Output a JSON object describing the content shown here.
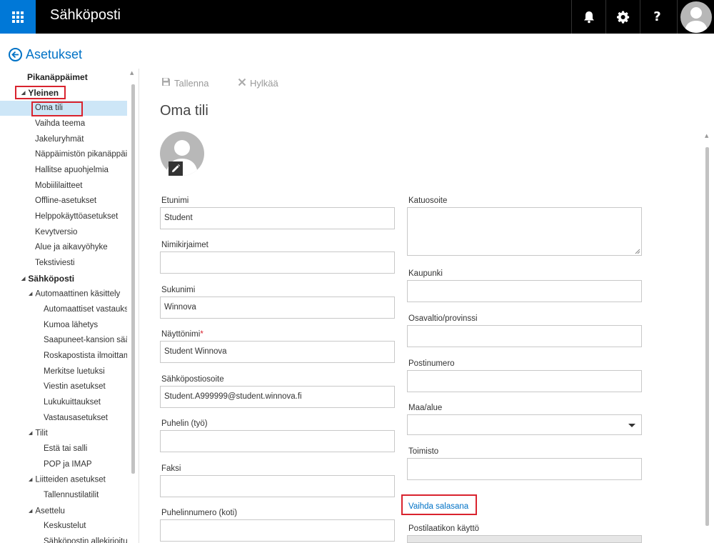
{
  "topbar": {
    "app_title": "Sähköposti",
    "waffle_icon": "app-launcher-icon",
    "bell_icon": "bell-icon",
    "gear_icon": "gear-icon",
    "help_glyph": "?",
    "avatar_icon": "user-avatar-icon",
    "accent_color": "#0078d7"
  },
  "settings": {
    "title": "Asetukset",
    "back_icon": "back-arrow-icon"
  },
  "nav": {
    "items": [
      {
        "label": "Pikanäppäimet"
      },
      {
        "label": "Yleinen"
      },
      {
        "label": "Oma tili"
      },
      {
        "label": "Vaihda teema"
      },
      {
        "label": "Jakeluryhmät"
      },
      {
        "label": "Näppäimistön pikanäppäimet"
      },
      {
        "label": "Hallitse apuohjelmia"
      },
      {
        "label": "Mobiililaitteet"
      },
      {
        "label": "Offline-asetukset"
      },
      {
        "label": "Helppokäyttöasetukset"
      },
      {
        "label": "Kevytversio"
      },
      {
        "label": "Alue ja aikavyöhyke"
      },
      {
        "label": "Tekstiviesti"
      },
      {
        "label": "Sähköposti"
      },
      {
        "label": "Automaattinen käsittely"
      },
      {
        "label": "Automaattiset vastaukset"
      },
      {
        "label": "Kumoa lähetys"
      },
      {
        "label": "Saapuneet-kansion säännöt"
      },
      {
        "label": "Roskapostista ilmoittaminen"
      },
      {
        "label": "Merkitse luetuksi"
      },
      {
        "label": "Viestin asetukset"
      },
      {
        "label": "Lukukuittaukset"
      },
      {
        "label": "Vastausasetukset"
      },
      {
        "label": "Tilit"
      },
      {
        "label": "Estä tai salli"
      },
      {
        "label": "POP ja IMAP"
      },
      {
        "label": "Liitteiden asetukset"
      },
      {
        "label": "Tallennustilatilit"
      },
      {
        "label": "Asettelu"
      },
      {
        "label": "Keskustelut"
      },
      {
        "label": "Sähköpostin allekirjoitus"
      }
    ],
    "expanded_marker": "◢",
    "selected_color": "#cde6f7"
  },
  "toolbar": {
    "save_label": "Tallenna",
    "save_icon": "save-icon",
    "discard_label": "Hylkää",
    "discard_icon": "close-icon"
  },
  "page": {
    "title": "Oma tili",
    "photo_icon": "profile-photo-icon",
    "edit_icon": "pencil-icon"
  },
  "form": {
    "left": [
      {
        "label": "Etunimi",
        "value": "Student"
      },
      {
        "label": "Nimikirjaimet",
        "value": ""
      },
      {
        "label": "Sukunimi",
        "value": "Winnova"
      },
      {
        "label": "Näyttönimi",
        "required_mark": "*",
        "value": "Student Winnova"
      },
      {
        "label": "Sähköpostiosoite",
        "value": "Student.A999999@student.winnova.fi"
      },
      {
        "label": "Puhelin (työ)",
        "value": ""
      },
      {
        "label": "Faksi",
        "value": ""
      },
      {
        "label": "Puhelinnumero (koti)",
        "value": ""
      }
    ],
    "right": [
      {
        "label": "Katuosoite",
        "value": ""
      },
      {
        "label": "Kaupunki",
        "value": ""
      },
      {
        "label": "Osavaltio/provinssi",
        "value": ""
      },
      {
        "label": "Postinumero",
        "value": ""
      },
      {
        "label": "Maa/alue",
        "value": ""
      },
      {
        "label": "Toimisto",
        "value": ""
      }
    ],
    "change_password": "Vaihda salasana",
    "mailbox_usage_label": "Postilaatikon käyttö"
  },
  "highlight_color": "#d9232e"
}
